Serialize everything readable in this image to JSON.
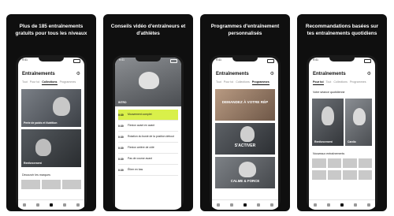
{
  "screens": [
    {
      "caption": "Plus de 185 entraînements gratuits pour tous les niveaux",
      "status_time": "9:41",
      "title": "Entraînements",
      "tabs": [
        "Tout",
        "Pour toi",
        "Collections",
        "Programmes"
      ],
      "active_tab": 2,
      "card1_label": "Perte de poids et Nutrition",
      "card2_label": "Renforcement",
      "section_label": "Découvrir les marques"
    },
    {
      "caption": "Conseils vidéo d'entraîneurs et d'athlètes",
      "status_time": "9:41",
      "video_label": "INTRO",
      "exercises": [
        {
          "time": "0:30",
          "label": "Mouvement complet"
        },
        {
          "time": "0:30",
          "label": "Flexion avant en avant"
        },
        {
          "time": "0:30",
          "label": "Rotation du buste de la position debout"
        },
        {
          "time": "0:30",
          "label": "Flexion arrière de côté"
        },
        {
          "time": "0:30",
          "label": "Pas de course avant"
        },
        {
          "time": "0:30",
          "label": "Étirer en bas"
        }
      ],
      "highlight_index": 0
    },
    {
      "caption": "Programmes d'entraînement personnalisés",
      "status_time": "9:41",
      "title": "Entraînements",
      "tabs": [
        "Tout",
        "Pour toi",
        "Collections",
        "Programmes"
      ],
      "active_tab": 3,
      "promo1": "DEMANDEZ À VOTRE RÉP",
      "promo2": "S'ACTIVER",
      "promo3": "CALME & FORCE"
    },
    {
      "caption": "Recommandations basées sur tes entraînements quotidiens",
      "status_time": "9:41",
      "title": "Entraînements",
      "tabs": [
        "Pour toi",
        "Tout",
        "Collections",
        "Programmes"
      ],
      "active_tab": 0,
      "section1": "Votre séance quotidienne",
      "card1_label": "Renforcement",
      "card2_label": "Cardio",
      "section2": "Nouveaux entraînements"
    }
  ],
  "colors": {
    "card_bg": "#0f0f0f",
    "accent": "#d9f04a",
    "screen_bg": "#ffffff"
  }
}
